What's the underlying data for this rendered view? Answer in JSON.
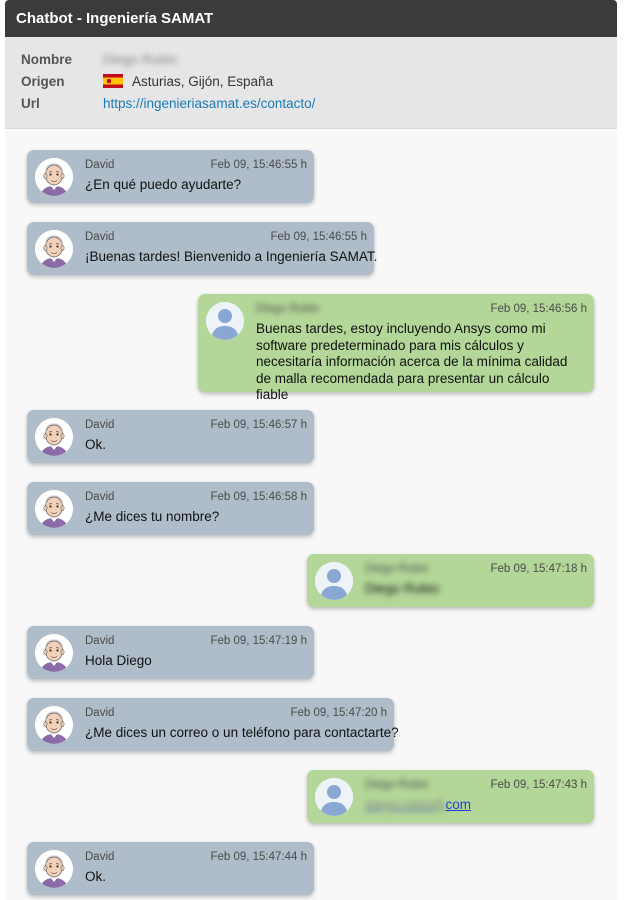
{
  "header": {
    "title": "Chatbot - Ingeniería SAMAT"
  },
  "meta": {
    "nombre_label": "Nombre",
    "nombre_value": "Diego Rubio",
    "origen_label": "Origen",
    "origen_flag_icon": "spain-flag-icon",
    "origen_value": "Asturias, Gijón, España",
    "url_label": "Url",
    "url_value": "https://ingenieriasamat.es/contacto/"
  },
  "colors": {
    "bot_bubble": "#aebdc9",
    "user_bubble": "#b3d799",
    "titlebar": "#3b3b3b",
    "link": "#1a7ab8"
  },
  "messages": [
    {
      "role": "bot",
      "sender": "David",
      "time": "Feb 09, 15:46:55 h",
      "text": "¿En qué puedo ayudarte?"
    },
    {
      "role": "bot",
      "sender": "David",
      "time": "Feb 09, 15:46:55 h",
      "text": "¡Buenas tardes! Bienvenido a Ingeniería SAMAT."
    },
    {
      "role": "user",
      "sender": "Diego Rubio",
      "time": "Feb 09, 15:46:56 h",
      "text": "Buenas tardes, estoy incluyendo Ansys como mi software predeterminado para mis cálculos y necesitaría información acerca de la mínima calidad de malla recomendada para presentar un cálculo fiable"
    },
    {
      "role": "bot",
      "sender": "David",
      "time": "Feb 09, 15:46:57 h",
      "text": "Ok."
    },
    {
      "role": "bot",
      "sender": "David",
      "time": "Feb 09, 15:46:58 h",
      "text": "¿Me dices tu nombre?"
    },
    {
      "role": "user",
      "sender": "Diego Rubio",
      "time": "Feb 09, 15:47:18 h",
      "text": "Diego Rubio"
    },
    {
      "role": "bot",
      "sender": "David",
      "time": "Feb 09, 15:47:19 h",
      "text": "Hola Diego"
    },
    {
      "role": "bot",
      "sender": "David",
      "time": "Feb 09, 15:47:20 h",
      "text": "¿Me dices un correo o un teléfono para contactarte?"
    },
    {
      "role": "user",
      "sender": "Diego Rubio",
      "time": "Feb 09, 15:47:43 h",
      "text_hidden": "diego.rubio@",
      "text_visible": "com"
    },
    {
      "role": "bot",
      "sender": "David",
      "time": "Feb 09, 15:47:44 h",
      "text": "Ok."
    }
  ]
}
